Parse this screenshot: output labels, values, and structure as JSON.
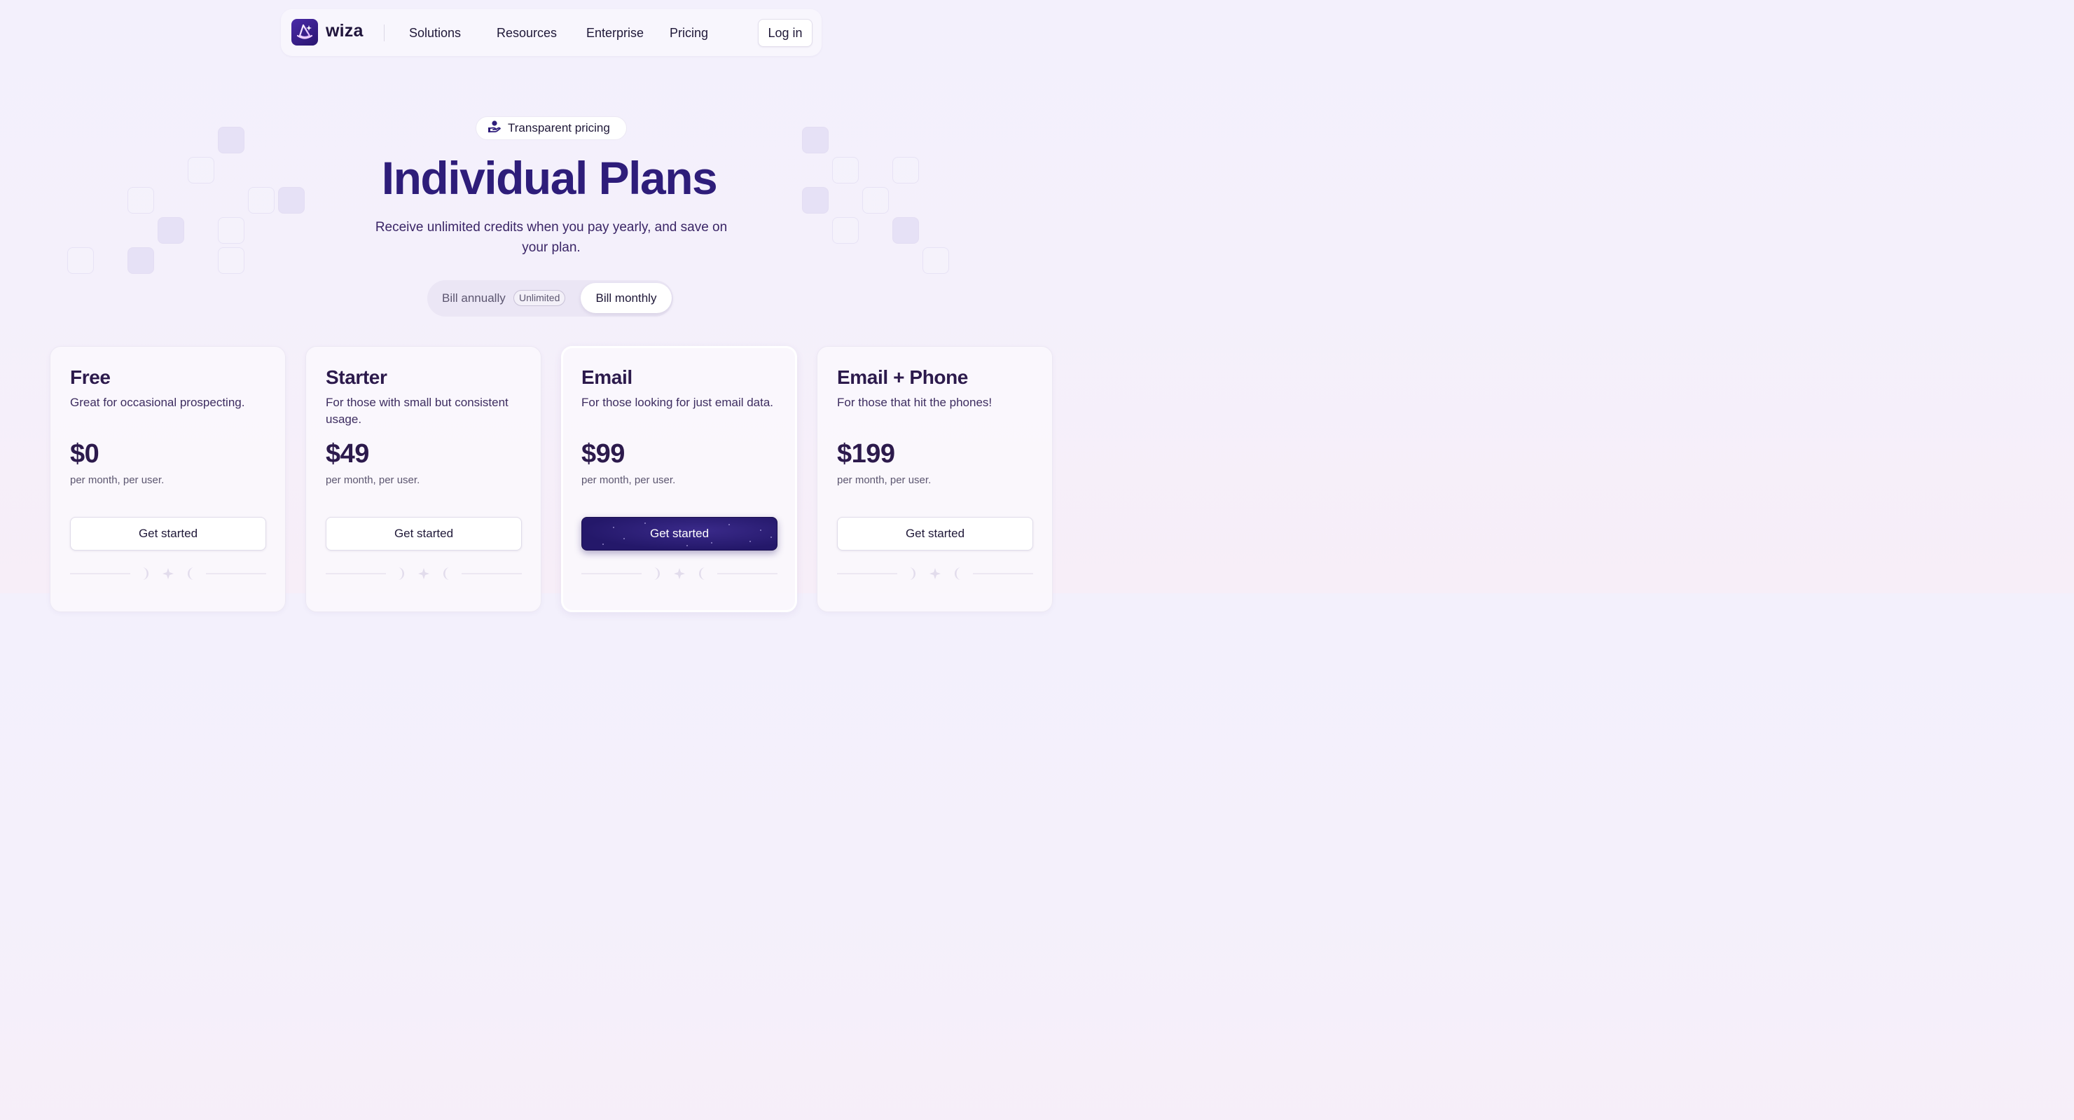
{
  "nav": {
    "brand": "wiza",
    "links": [
      "Solutions",
      "Resources",
      "Enterprise",
      "Pricing"
    ],
    "login": "Log in"
  },
  "hero": {
    "badge": "Transparent pricing",
    "title": "Individual Plans",
    "subtitle": "Receive unlimited credits when you pay yearly, and save on your plan."
  },
  "billing": {
    "annual_label": "Bill annually",
    "annual_tag": "Unlimited",
    "monthly_label": "Bill monthly",
    "selected": "monthly"
  },
  "plans": [
    {
      "name": "Free",
      "description": "Great for occasional prospecting.",
      "price": "$0",
      "period": "per month, per user.",
      "cta": "Get started",
      "featured": false
    },
    {
      "name": "Starter",
      "description": "For those with small but consistent usage.",
      "price": "$49",
      "period": "per month, per user.",
      "cta": "Get started",
      "featured": false
    },
    {
      "name": "Email",
      "description": "For those looking for just email data.",
      "price": "$99",
      "period": "per month, per user.",
      "cta": "Get started",
      "featured": true
    },
    {
      "name": "Email + Phone",
      "description": "For those that hit the phones!",
      "price": "$199",
      "period": "per month, per user.",
      "cta": "Get started",
      "featured": false
    }
  ],
  "colors": {
    "brand_dark": "#2e1d7a",
    "primary_button": "#24186a",
    "background": "#f3f0fc"
  }
}
